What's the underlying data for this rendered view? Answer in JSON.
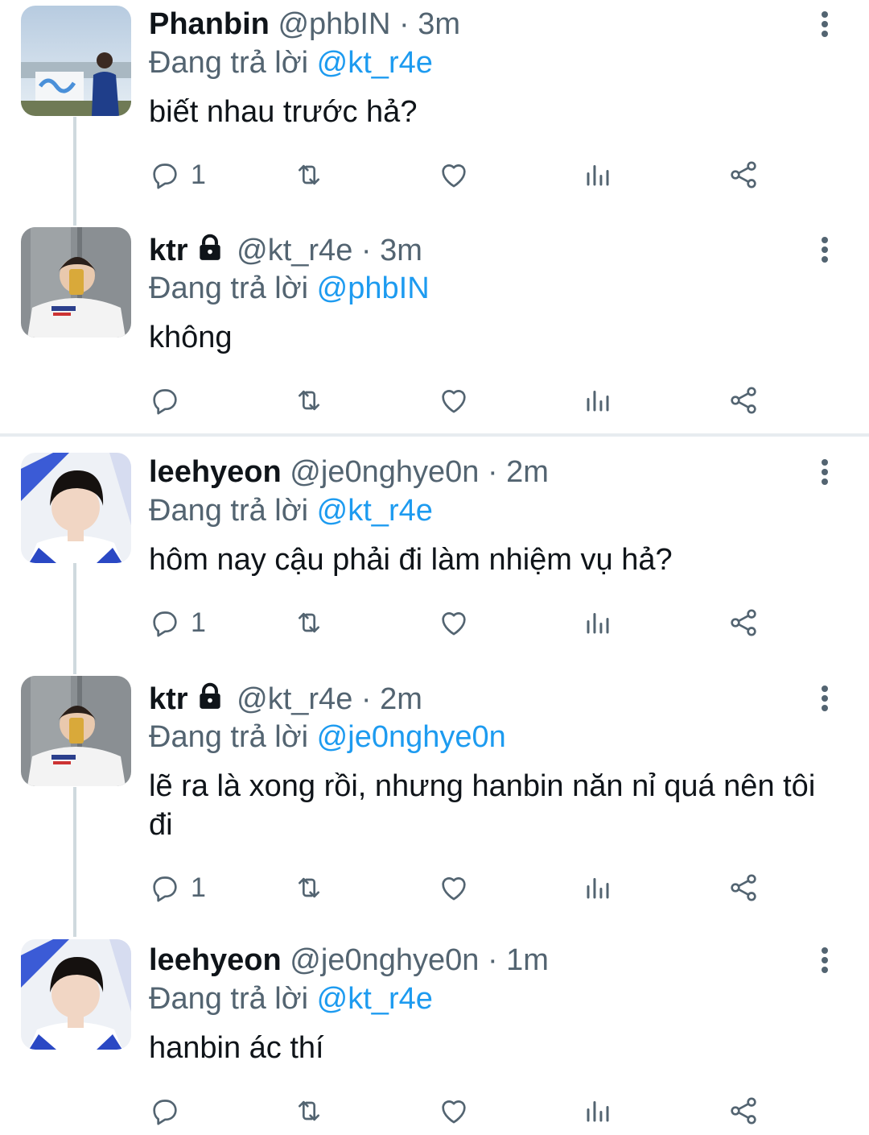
{
  "tweets": [
    {
      "name": "Phanbin",
      "handle": "@phbIN",
      "sep": "·",
      "time": "3m",
      "reply_prefix": "Đang trả lời",
      "reply_mention": "@kt_r4e",
      "text": "biết nhau trước hả?",
      "reply_count": "1",
      "locked": false,
      "avatar": "photo-man-riverside"
    },
    {
      "name": "ktr",
      "handle": "@kt_r4e",
      "sep": "·",
      "time": "3m",
      "reply_prefix": "Đang trả lời",
      "reply_mention": "@phbIN",
      "text": "không",
      "reply_count": "",
      "locked": true,
      "avatar": "photo-mirror-selfie"
    },
    {
      "name": "leehyeon",
      "handle": "@je0nghye0n",
      "sep": "·",
      "time": "2m",
      "reply_prefix": "Đang trả lời",
      "reply_mention": "@kt_r4e",
      "text": "hôm nay cậu phải đi làm nhiệm vụ hả?",
      "reply_count": "1",
      "locked": false,
      "avatar": "photo-portrait"
    },
    {
      "name": "ktr",
      "handle": "@kt_r4e",
      "sep": "·",
      "time": "2m",
      "reply_prefix": "Đang trả lời",
      "reply_mention": "@je0nghye0n",
      "text": "lẽ ra là xong rồi, nhưng hanbin năn nỉ quá nên tôi đi",
      "reply_count": "1",
      "locked": true,
      "avatar": "photo-mirror-selfie"
    },
    {
      "name": "leehyeon",
      "handle": "@je0nghye0n",
      "sep": "·",
      "time": "1m",
      "reply_prefix": "Đang trả lời",
      "reply_mention": "@kt_r4e",
      "text": "hanbin ác thí",
      "reply_count": "",
      "locked": false,
      "avatar": "photo-portrait"
    }
  ],
  "icons": {
    "reply": "reply-icon",
    "retweet": "retweet-icon",
    "like": "heart-icon",
    "views": "analytics-icon",
    "share": "share-icon",
    "more": "more-vertical-icon",
    "lock": "lock-icon"
  },
  "colors": {
    "mention": "#1d9bf0",
    "secondary_text": "#536471",
    "primary_text": "#0f1419",
    "thread_line": "#cfd9de"
  }
}
